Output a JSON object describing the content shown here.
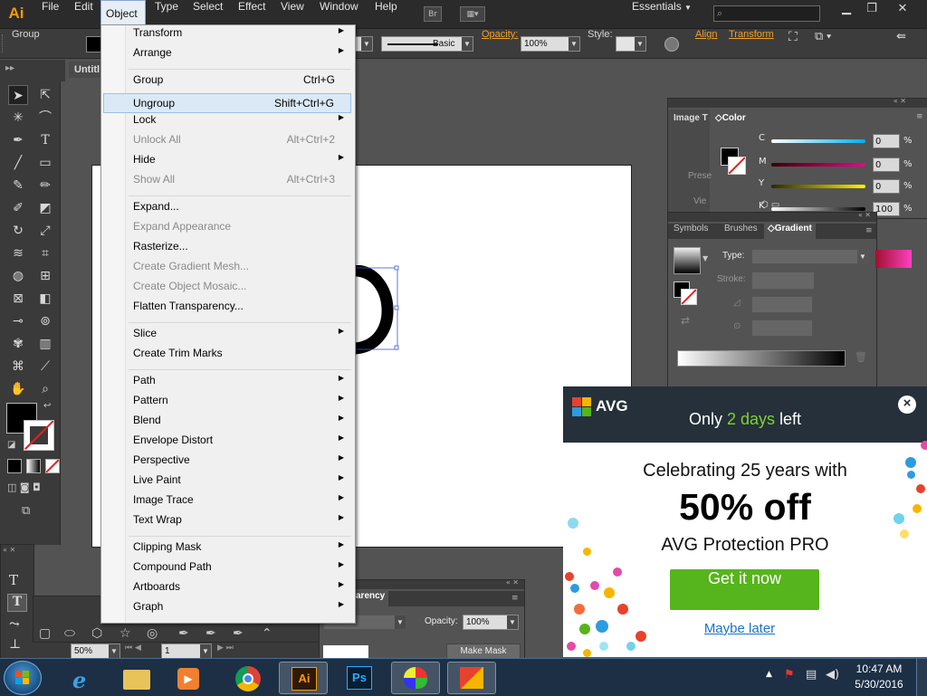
{
  "app": {
    "logo_text": "Ai",
    "workspace": "Essentials",
    "bridge_label": "Br",
    "search_placeholder": ""
  },
  "menubar": {
    "items": [
      "File",
      "Edit",
      "Object",
      "Type",
      "Select",
      "Effect",
      "View",
      "Window",
      "Help"
    ],
    "active": "Object"
  },
  "control_bar": {
    "selection_label": "Group",
    "stroke_profile": "Basic",
    "opacity_label": "Opacity:",
    "opacity_value": "100%",
    "style_label": "Style:",
    "align_link": "Align",
    "transform_link": "Transform"
  },
  "document": {
    "tab_title": "Untitl"
  },
  "object_menu": {
    "groups": [
      [
        {
          "label": "Transform",
          "submenu": true
        },
        {
          "label": "Arrange",
          "submenu": true
        }
      ],
      [
        {
          "label": "Group",
          "shortcut": "Ctrl+G"
        },
        {
          "label": "Ungroup",
          "shortcut": "Shift+Ctrl+G",
          "highlighted": true
        },
        {
          "label": "Lock",
          "submenu": true
        },
        {
          "label": "Unlock All",
          "shortcut": "Alt+Ctrl+2",
          "disabled": true
        },
        {
          "label": "Hide",
          "submenu": true
        },
        {
          "label": "Show All",
          "shortcut": "Alt+Ctrl+3",
          "disabled": true
        }
      ],
      [
        {
          "label": "Expand..."
        },
        {
          "label": "Expand Appearance",
          "disabled": true
        },
        {
          "label": "Rasterize..."
        },
        {
          "label": "Create Gradient Mesh...",
          "disabled": true
        },
        {
          "label": "Create Object Mosaic...",
          "disabled": true
        },
        {
          "label": "Flatten Transparency..."
        }
      ],
      [
        {
          "label": "Slice",
          "submenu": true
        },
        {
          "label": "Create Trim Marks"
        }
      ],
      [
        {
          "label": "Path",
          "submenu": true
        },
        {
          "label": "Pattern",
          "submenu": true
        },
        {
          "label": "Blend",
          "submenu": true
        },
        {
          "label": "Envelope Distort",
          "submenu": true
        },
        {
          "label": "Perspective",
          "submenu": true
        },
        {
          "label": "Live Paint",
          "submenu": true
        },
        {
          "label": "Image Trace",
          "submenu": true
        },
        {
          "label": "Text Wrap",
          "submenu": true
        }
      ],
      [
        {
          "label": "Clipping Mask",
          "submenu": true
        },
        {
          "label": "Compound Path",
          "submenu": true
        },
        {
          "label": "Artboards",
          "submenu": true
        },
        {
          "label": "Graph",
          "submenu": true
        }
      ]
    ]
  },
  "color_panel": {
    "title": "Color",
    "side_tab": "Image T",
    "side_preset": "Prese",
    "side_view": "Vie",
    "channels": [
      {
        "label": "C",
        "value": "0",
        "unit": "%",
        "color": "#00aeef"
      },
      {
        "label": "M",
        "value": "0",
        "unit": "%",
        "color": "#ec008c"
      },
      {
        "label": "Y",
        "value": "0",
        "unit": "%",
        "color": "#fff200"
      },
      {
        "label": "K",
        "value": "100",
        "unit": "%",
        "color": "#000000"
      }
    ]
  },
  "gradient_panel": {
    "tabs": [
      "Symbols",
      "Brushes",
      "Gradient"
    ],
    "active_tab": "Gradient",
    "type_label": "Type:",
    "stroke_label": "Stroke:"
  },
  "transparency_panel": {
    "title": "arency",
    "blend_mode": "Normal",
    "opacity_label": "Opacity:",
    "opacity_value": "100%",
    "make_mask": "Make Mask"
  },
  "bottom_bar": {
    "zoom": "50%",
    "artboard": "1"
  },
  "ad": {
    "brand": "AVG",
    "banner_prefix": "Only ",
    "banner_highlight": "2 days",
    "banner_suffix": " left",
    "line1": "Celebrating 25 years with",
    "headline": "50% off",
    "product": "AVG Protection PRO",
    "cta": "Get it now",
    "dismiss": "Maybe later",
    "close_glyph": "×"
  },
  "taskbar": {
    "apps": [
      "start",
      "ie",
      "explorer",
      "media-player",
      "chrome",
      "illustrator",
      "photoshop",
      "paint",
      "avg"
    ],
    "app_labels": {
      "illustrator": "Ai",
      "photoshop": "Ps"
    },
    "clock_time": "10:47 AM",
    "clock_date": "5/30/2016"
  },
  "colors": {
    "accent": "#ff9a00",
    "avg_green": "#56b41c",
    "link": "#1a73c8"
  }
}
